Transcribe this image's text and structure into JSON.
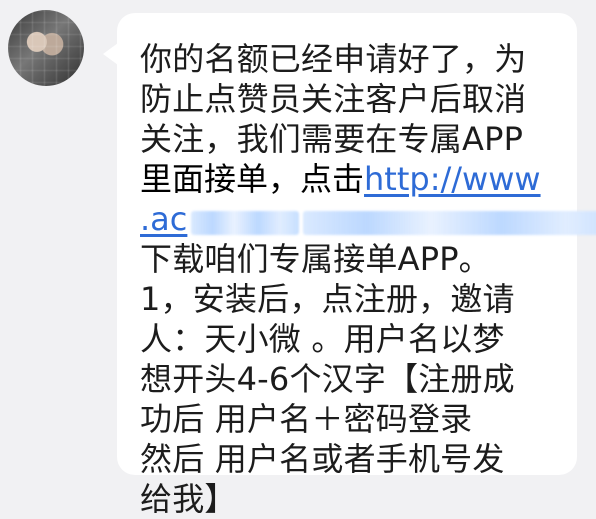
{
  "chat": {
    "lines": [
      "你的名额已经申请好了，为",
      "防止点赞员关注客户后取消",
      "关注，我们需要在专属APP",
      "下载咱们专属接单APP。",
      "1，安装后，点注册，邀请",
      "人：天小微 。用户名以梦",
      "想开头4-6个汉字【注册成",
      "功后  用户名＋密码登录",
      "然后  用户名或者手机号发",
      "给我】"
    ],
    "link_prefix": "里面接单，点击",
    "link_part1": "http://www",
    "link_part2": ".ac"
  }
}
